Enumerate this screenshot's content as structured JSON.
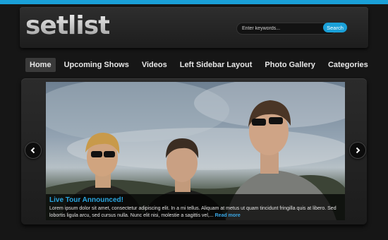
{
  "site": {
    "logo": "setlist"
  },
  "search": {
    "placeholder": "Enter keywords...",
    "button": "Search"
  },
  "nav": {
    "items": [
      {
        "label": "Home"
      },
      {
        "label": "Upcoming Shows"
      },
      {
        "label": "Videos"
      },
      {
        "label": "Left Sidebar Layout"
      },
      {
        "label": "Photo Gallery"
      },
      {
        "label": "Categories"
      }
    ]
  },
  "slider": {
    "title": "Live Tour Announced!",
    "text": "Lorem ipsum dolor sit amet, consectetur adipiscing elit. In a mi tellus. Aliquam at metus ut quam tincidunt fringilla quis at libero. Sed lobortis ligula arcu, sed cursus nulla. Nunc elit nisi, molestie a sagittis vel,...",
    "read_more": "Read more",
    "prev_icon": "chevron-left-icon",
    "next_icon": "chevron-right-icon"
  },
  "colors": {
    "accent": "#1aa0d8",
    "background": "#161616"
  }
}
